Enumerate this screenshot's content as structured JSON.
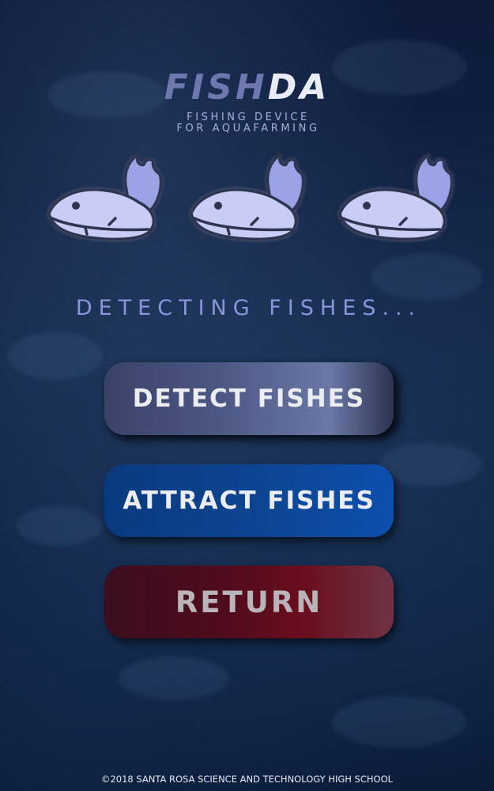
{
  "app": {
    "brand_part1": "FISH",
    "brand_part2": "DA",
    "tagline_line1": "FISHING DEVICE",
    "tagline_line2": "FOR AQUAFARMING"
  },
  "status_text": "DETECTING FISHES...",
  "icons": [
    "fish-icon",
    "fish-icon",
    "fish-icon"
  ],
  "buttons": {
    "detect": "DETECT FISHES",
    "attract": "ATTRACT FISHES",
    "return": "RETURN"
  },
  "footer": "©2018 SANTA ROSA SCIENCE AND TECHNOLOGY HIGH SCHOOL",
  "colors": {
    "background": "#0d1a3a",
    "brand_fish": "#6f78ae",
    "brand_da": "#e9ecf6",
    "status_text": "#8d94de",
    "fish_body": "#c9cdf5",
    "fish_outline": "#2e3550",
    "detect_button": "#4c5784",
    "attract_button": "#0d4490",
    "return_button": "#5a0c1c"
  }
}
